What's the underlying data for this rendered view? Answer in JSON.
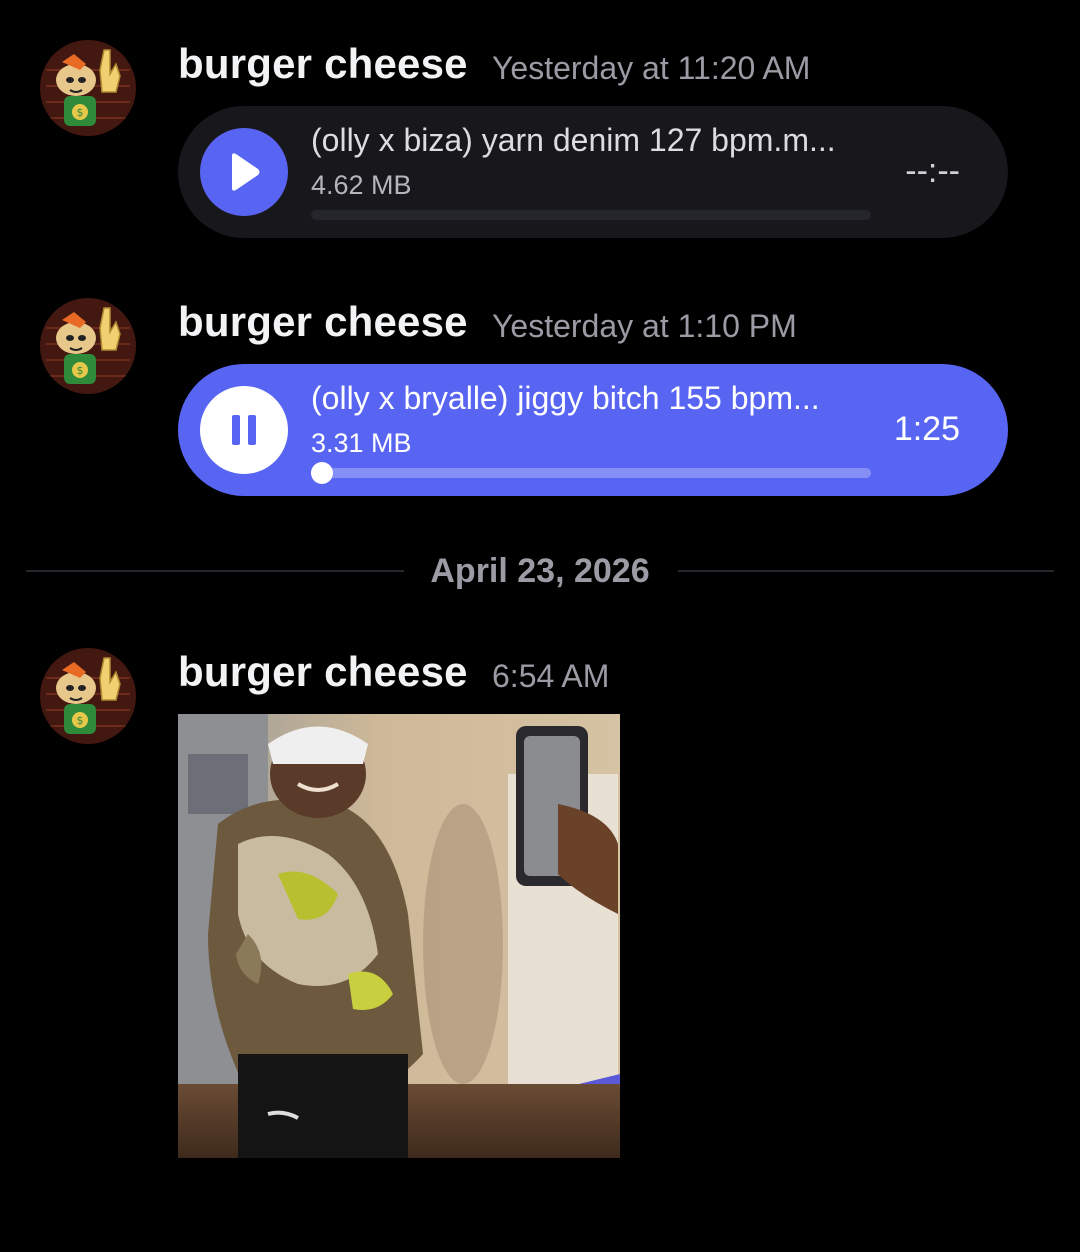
{
  "colors": {
    "background": "#000000",
    "accent": "#5865f2",
    "username": "#f2f3f5",
    "timestamp": "#9a9ba4",
    "idle_player": "#17171c"
  },
  "messages": [
    {
      "username": "burger cheese",
      "timestamp": "Yesterday at 11:20 AM",
      "avatar_icon": "avatar-cartoon-icon",
      "attachment": {
        "type": "audio",
        "state": "idle",
        "filename": "(olly x biza) yarn denim 127 bpm.m...",
        "size": "4.62 MB",
        "time": "--:--",
        "progress": 0,
        "button_icon": "play-icon"
      }
    },
    {
      "username": "burger cheese",
      "timestamp": "Yesterday at 1:10 PM",
      "avatar_icon": "avatar-cartoon-icon",
      "attachment": {
        "type": "audio",
        "state": "playing",
        "filename": "(olly x bryalle) jiggy bitch 155 bpm...",
        "size": "3.31 MB",
        "time": "1:25",
        "progress": 0.02,
        "button_icon": "pause-icon"
      }
    },
    {
      "username": "burger cheese",
      "timestamp": "6:54 AM",
      "avatar_icon": "avatar-cartoon-icon",
      "attachment": {
        "type": "image"
      }
    }
  ],
  "date_divider": "April 23, 2026"
}
